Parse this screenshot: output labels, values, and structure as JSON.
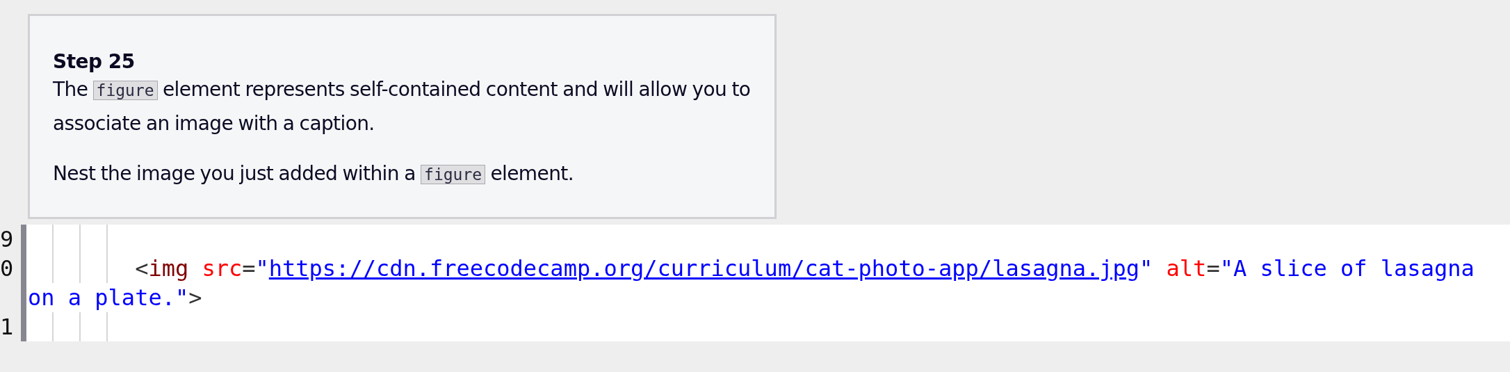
{
  "instructions": {
    "title": "Step 25",
    "paragraphs": [
      [
        {
          "kind": "text",
          "text": "The "
        },
        {
          "kind": "code",
          "text": "figure"
        },
        {
          "kind": "text",
          "text": " element represents self-contained content and will allow you to associate an image with a caption."
        }
      ],
      [
        {
          "kind": "text",
          "text": "Nest the image you just added within a "
        },
        {
          "kind": "code",
          "text": "figure"
        },
        {
          "kind": "text",
          "text": " element."
        }
      ]
    ]
  },
  "editor": {
    "lines": [
      {
        "number": "9"
      },
      {
        "number": "0",
        "rows": [
          {
            "tokens": [
              {
                "kind": "punct",
                "text": "<"
              },
              {
                "kind": "tag",
                "text": "img"
              },
              {
                "kind": "attr",
                "text": " src"
              },
              {
                "kind": "punct",
                "text": "="
              },
              {
                "kind": "string",
                "text": "\""
              },
              {
                "kind": "link",
                "text": "https://cdn.freecodecamp.org/curriculum/cat-photo-app/lasagna.jpg"
              },
              {
                "kind": "string",
                "text": "\""
              },
              {
                "kind": "attr",
                "text": " alt"
              },
              {
                "kind": "punct",
                "text": "="
              },
              {
                "kind": "string",
                "text": "\"A slice of lasagna"
              }
            ]
          },
          {
            "tokens": [
              {
                "kind": "string",
                "text": "on a plate.\""
              },
              {
                "kind": "punct",
                "text": ">"
              }
            ]
          }
        ]
      },
      {
        "number": "1"
      }
    ]
  }
}
